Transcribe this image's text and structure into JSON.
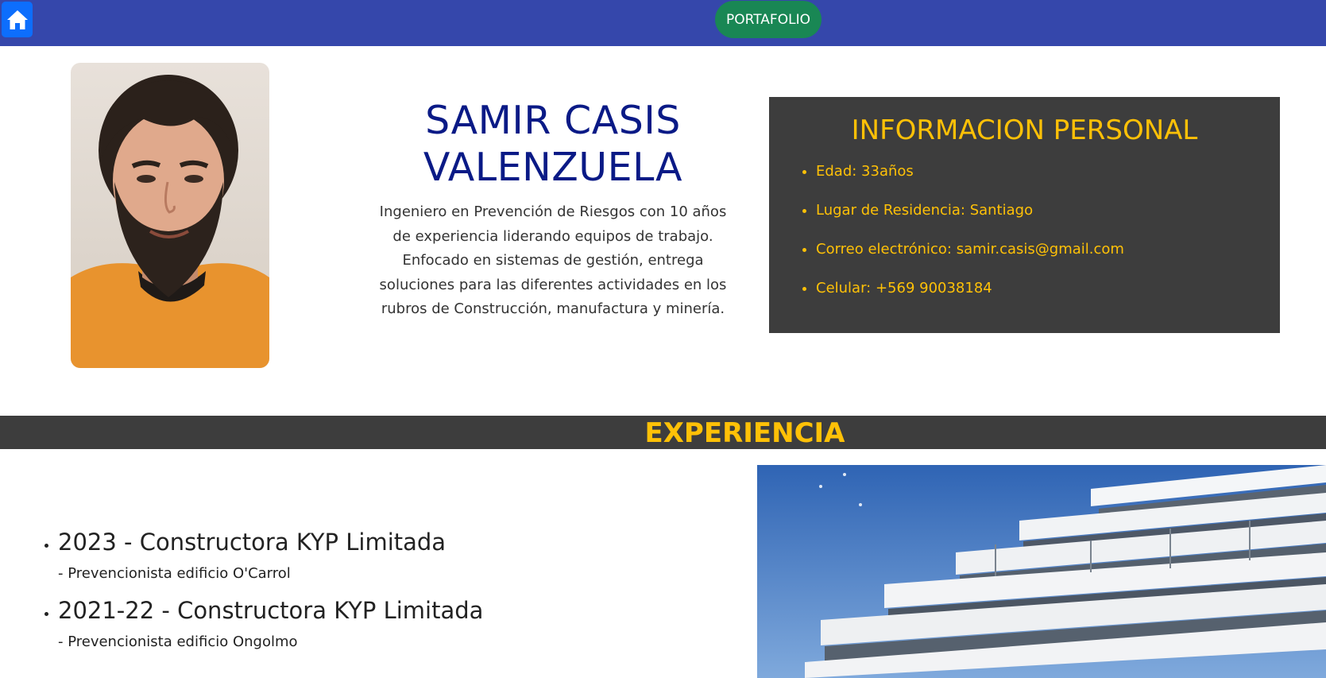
{
  "nav": {
    "home_icon": "house-icon",
    "portfolio_label": "PORTAFOLIO"
  },
  "profile": {
    "name": "SAMIR CASIS VALENZUELA",
    "summary": "Ingeniero en Prevención de Riesgos con 10 años de experiencia liderando equipos de trabajo. Enfocado en sistemas de gestión, entrega soluciones para las diferentes actividades en los rubros de Construcción, manufactura y minería."
  },
  "personal_info": {
    "title": "INFORMACION PERSONAL",
    "items": [
      "Edad: 33años",
      "Lugar de Residencia: Santiago",
      "Correo electrónico: samir.casis@gmail.com",
      "Celular: +569 90038184"
    ]
  },
  "experience": {
    "title": "EXPERIENCIA",
    "items": [
      {
        "heading": "2023 - Constructora KYP Limitada",
        "role": "- Prevencionista edificio O'Carrol"
      },
      {
        "heading": "2021-22 - Constructora KYP Limitada",
        "role": "- Prevencionista edificio Ongolmo"
      }
    ]
  },
  "colors": {
    "navbar": "#3547ab",
    "home_button": "#0d6efd",
    "portfolio_button": "#198754",
    "accent_yellow": "#ffc107",
    "dark_panel": "#3d3d3d",
    "name_blue": "#0a1a86"
  }
}
